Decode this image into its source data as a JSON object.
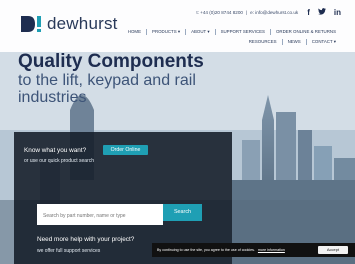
{
  "brand": {
    "name": "dewhurst"
  },
  "contact": {
    "phone": "t: +44 (0)20 8744 8200",
    "separator": "|",
    "email": "e: info@dewhurst.co.uk"
  },
  "social": {
    "facebook": "f",
    "twitter": "t",
    "linkedin": "in"
  },
  "nav": {
    "row1": [
      "HOME",
      "PRODUCTS ▾",
      "ABOUT ▾",
      "SUPPORT SERVICES",
      "ORDER ONLINE & RETURNS"
    ],
    "row2": [
      "RESOURCES",
      "NEWS",
      "CONTACT ▾"
    ]
  },
  "hero": {
    "title": "Quality Components",
    "subtitle": "to the lift, keypad and rail industries"
  },
  "panel": {
    "question1": "Know what you want?",
    "order_button": "Order Online",
    "question1_sub": "or use our quick product search",
    "search_placeholder": "Search by part number, name or type",
    "search_button": "Search",
    "question2": "Need more help with your project?",
    "question2_sub": "we offer full support services"
  },
  "cookie": {
    "text": "By continuing to use the site, you agree to the use of cookies.",
    "link": "more information",
    "accept": "Accept"
  }
}
